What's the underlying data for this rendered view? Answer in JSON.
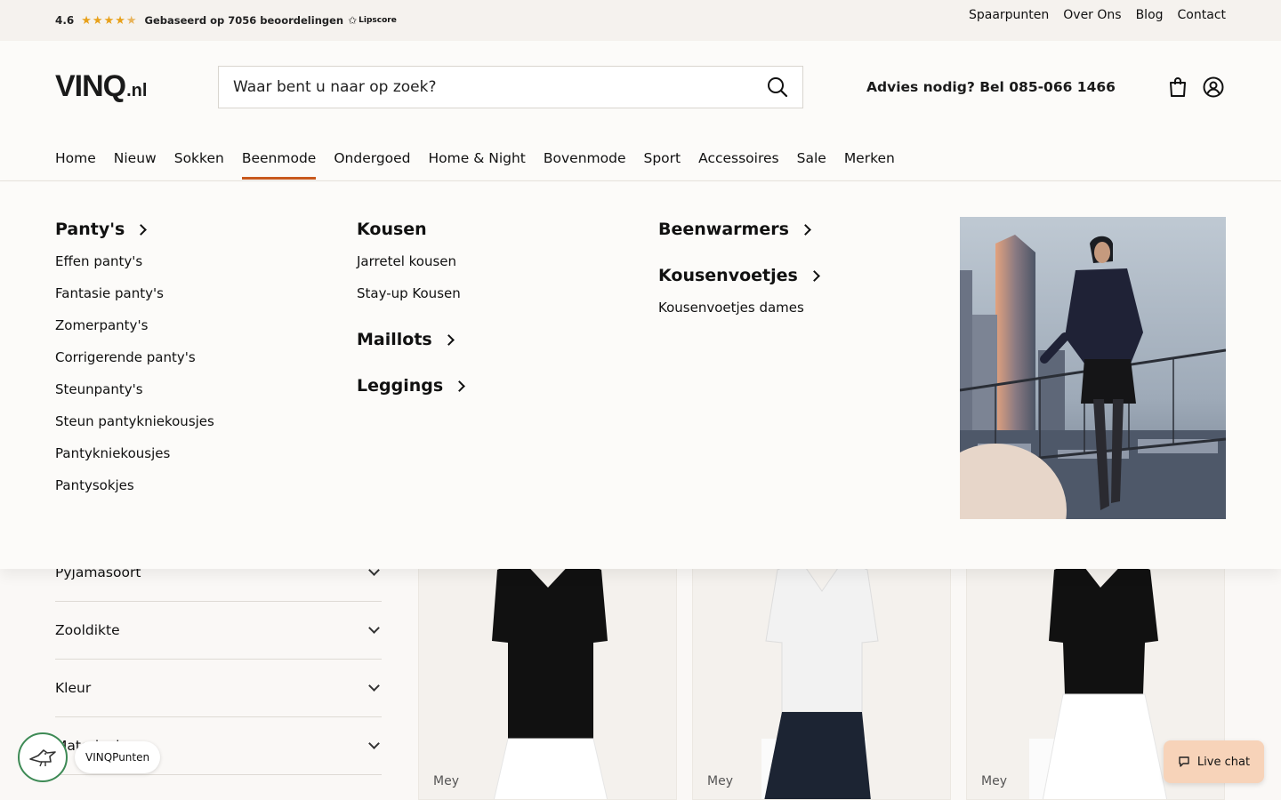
{
  "topbar": {
    "rating_score": "4.6",
    "rating_text": "Gebaseerd op 7056 beoordelingen",
    "rating_brand": "Lipscore",
    "links": [
      "Spaarpunten",
      "Over Ons",
      "Blog",
      "Contact"
    ]
  },
  "header": {
    "logo_main": "VINQ",
    "logo_suffix": ".nl",
    "search_placeholder": "Waar bent u naar op zoek?",
    "advice": "Advies nodig? Bel 085-066 1466"
  },
  "nav": {
    "items": [
      "Home",
      "Nieuw",
      "Sokken",
      "Beenmode",
      "Ondergoed",
      "Home & Night",
      "Bovenmode",
      "Sport",
      "Accessoires",
      "Sale",
      "Merken"
    ],
    "active_index": 3
  },
  "menu": {
    "col1": {
      "heading": "Panty's",
      "items": [
        "Effen panty's",
        "Fantasie panty's",
        "Zomerpanty's",
        "Corrigerende panty's",
        "Steunpanty's",
        "Steun pantykniekousjes",
        "Pantykniekousjes",
        "Pantysokjes"
      ]
    },
    "col2": {
      "heading": "Kousen",
      "items": [
        "Jarretel kousen",
        "Stay-up Kousen"
      ],
      "heading2": "Maillots",
      "heading3": "Leggings"
    },
    "col3": {
      "heading": "Beenwarmers",
      "heading2": "Kousenvoetjes",
      "items": [
        "Kousenvoetjes dames"
      ]
    }
  },
  "filters": [
    "Pyjamasoort",
    "Zooldikte",
    "Kleur",
    "Materiaal"
  ],
  "products": [
    {
      "brand": "Mey",
      "shirt": "#111111",
      "pants": "#ffffff"
    },
    {
      "brand": "Mey",
      "shirt": "#f2f2f2",
      "pants": "#1c2433"
    },
    {
      "brand": "Mey",
      "shirt": "#111111",
      "pants": "#ffffff"
    }
  ],
  "widgets": {
    "points_label": "VINQPunten",
    "chat_label": "Live chat"
  },
  "colors": {
    "accent": "#c8591e",
    "chat_bg": "#f7d3b9",
    "badge_border": "#3d8a55",
    "star": "#e8a11a"
  }
}
